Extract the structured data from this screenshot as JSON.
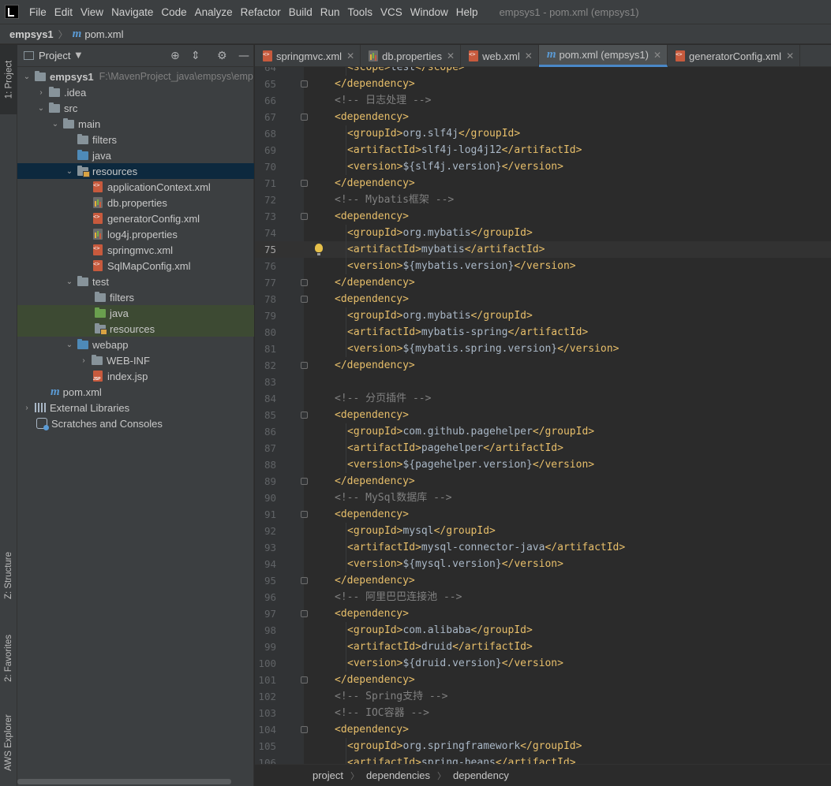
{
  "menu": {
    "items": [
      "File",
      "Edit",
      "View",
      "Navigate",
      "Code",
      "Analyze",
      "Refactor",
      "Build",
      "Run",
      "Tools",
      "VCS",
      "Window",
      "Help"
    ],
    "window_title": "empsys1 - pom.xml (empsys1)"
  },
  "navbar": {
    "project": "empsys1",
    "file": "pom.xml"
  },
  "side_tabs": {
    "project": "1: Project",
    "structure": "Z: Structure",
    "favorites": "2: Favorites",
    "aws": "AWS Explorer"
  },
  "project_panel": {
    "title": "Project",
    "tree": [
      {
        "label": "empsys1",
        "hint": "F:\\MavenProject_java\\empsys\\emp",
        "bold": true
      },
      {
        "label": ".idea"
      },
      {
        "label": "src"
      },
      {
        "label": "main"
      },
      {
        "label": "filters"
      },
      {
        "label": "java"
      },
      {
        "label": "resources"
      },
      {
        "label": "applicationContext.xml"
      },
      {
        "label": "db.properties"
      },
      {
        "label": "generatorConfig.xml"
      },
      {
        "label": "log4j.properties"
      },
      {
        "label": "springmvc.xml"
      },
      {
        "label": "SqlMapConfig.xml"
      },
      {
        "label": "test"
      },
      {
        "label": "filters"
      },
      {
        "label": "java"
      },
      {
        "label": "resources"
      },
      {
        "label": "webapp"
      },
      {
        "label": "WEB-INF"
      },
      {
        "label": "index.jsp"
      },
      {
        "label": "pom.xml"
      },
      {
        "label": "External Libraries"
      },
      {
        "label": "Scratches and Consoles"
      }
    ]
  },
  "tabs": [
    {
      "label": "springmvc.xml",
      "active": false
    },
    {
      "label": "db.properties",
      "active": false
    },
    {
      "label": "web.xml",
      "active": false
    },
    {
      "label": "pom.xml (empsys1)",
      "active": true
    },
    {
      "label": "generatorConfig.xml",
      "active": false
    }
  ],
  "editor": {
    "current_line": 75,
    "lines": [
      {
        "n": "64",
        "i": 2,
        "t": "<scope>test</scope>"
      },
      {
        "n": "65",
        "i": 1,
        "t": "</dependency>"
      },
      {
        "n": "66",
        "i": 1,
        "t": "<!-- 日志处理 -->"
      },
      {
        "n": "67",
        "i": 1,
        "t": "<dependency>"
      },
      {
        "n": "68",
        "i": 2,
        "t": "<groupId>org.slf4j</groupId>"
      },
      {
        "n": "69",
        "i": 2,
        "t": "<artifactId>slf4j-log4j12</artifactId>"
      },
      {
        "n": "70",
        "i": 2,
        "t": "<version>${slf4j.version}</version>"
      },
      {
        "n": "71",
        "i": 1,
        "t": "</dependency>"
      },
      {
        "n": "72",
        "i": 1,
        "t": "<!-- Mybatis框架 -->"
      },
      {
        "n": "73",
        "i": 1,
        "t": "<dependency>"
      },
      {
        "n": "74",
        "i": 2,
        "t": "<groupId>org.mybatis</groupId>"
      },
      {
        "n": "75",
        "i": 2,
        "t": "<artifactId>mybatis</artifactId>"
      },
      {
        "n": "76",
        "i": 2,
        "t": "<version>${mybatis.version}</version>"
      },
      {
        "n": "77",
        "i": 1,
        "t": "</dependency>"
      },
      {
        "n": "78",
        "i": 1,
        "t": "<dependency>"
      },
      {
        "n": "79",
        "i": 2,
        "t": "<groupId>org.mybatis</groupId>"
      },
      {
        "n": "80",
        "i": 2,
        "t": "<artifactId>mybatis-spring</artifactId>"
      },
      {
        "n": "81",
        "i": 2,
        "t": "<version>${mybatis.spring.version}</version>"
      },
      {
        "n": "82",
        "i": 1,
        "t": "</dependency>"
      },
      {
        "n": "83",
        "i": 0,
        "t": ""
      },
      {
        "n": "84",
        "i": 1,
        "t": "<!-- 分页插件 -->"
      },
      {
        "n": "85",
        "i": 1,
        "t": "<dependency>"
      },
      {
        "n": "86",
        "i": 2,
        "t": "<groupId>com.github.pagehelper</groupId>"
      },
      {
        "n": "87",
        "i": 2,
        "t": "<artifactId>pagehelper</artifactId>"
      },
      {
        "n": "88",
        "i": 2,
        "t": "<version>${pagehelper.version}</version>"
      },
      {
        "n": "89",
        "i": 1,
        "t": "</dependency>"
      },
      {
        "n": "90",
        "i": 1,
        "t": "<!-- MySql数据库 -->"
      },
      {
        "n": "91",
        "i": 1,
        "t": "<dependency>"
      },
      {
        "n": "92",
        "i": 2,
        "t": "<groupId>mysql</groupId>"
      },
      {
        "n": "93",
        "i": 2,
        "t": "<artifactId>mysql-connector-java</artifactId>"
      },
      {
        "n": "94",
        "i": 2,
        "t": "<version>${mysql.version}</version>"
      },
      {
        "n": "95",
        "i": 1,
        "t": "</dependency>"
      },
      {
        "n": "96",
        "i": 1,
        "t": "<!-- 阿里巴巴连接池 -->"
      },
      {
        "n": "97",
        "i": 1,
        "t": "<dependency>"
      },
      {
        "n": "98",
        "i": 2,
        "t": "<groupId>com.alibaba</groupId>"
      },
      {
        "n": "99",
        "i": 2,
        "t": "<artifactId>druid</artifactId>"
      },
      {
        "n": "100",
        "i": 2,
        "t": "<version>${druid.version}</version>"
      },
      {
        "n": "101",
        "i": 1,
        "t": "</dependency>"
      },
      {
        "n": "102",
        "i": 1,
        "t": "<!-- Spring支持 -->"
      },
      {
        "n": "103",
        "i": 1,
        "t": "<!-- IOC容器 -->"
      },
      {
        "n": "104",
        "i": 1,
        "t": "<dependency>"
      },
      {
        "n": "105",
        "i": 2,
        "t": "<groupId>org.springframework</groupId>"
      },
      {
        "n": "106",
        "i": 2,
        "t": "<artifactId>spring-beans</artifactId>"
      }
    ]
  },
  "breadcrumb": [
    "project",
    "dependencies",
    "dependency"
  ],
  "colors": {
    "tag": "#e8bf6a",
    "text": "#a9b7c6",
    "comment": "#808080",
    "accent": "#4a88c7"
  }
}
